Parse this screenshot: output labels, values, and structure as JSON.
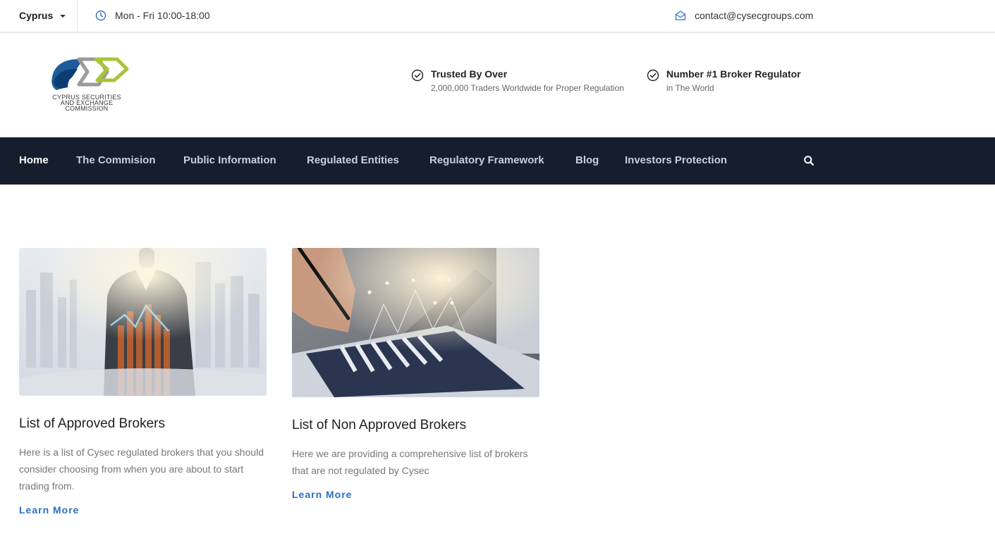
{
  "topbar": {
    "country": "Cyprus",
    "hours": "Mon - Fri 10:00-18:00",
    "email": "contact@cysecgroups.com"
  },
  "header": {
    "logo_text": [
      "CYPRUS SECURITIES",
      "AND EXCHANGE",
      "COMMISSION"
    ],
    "features": [
      {
        "title": "Trusted By Over",
        "subtitle": "2,000,000 Traders Worldwide for Proper Regulation"
      },
      {
        "title": "Number #1 Broker Regulator",
        "subtitle": "in The World"
      }
    ]
  },
  "nav": {
    "items": [
      {
        "label": "Home"
      },
      {
        "label": "The Commision"
      },
      {
        "label": "Public Information"
      },
      {
        "label": "Regulated Entities"
      },
      {
        "label": "Regulatory Framework"
      },
      {
        "label": "Blog"
      },
      {
        "label": "Investors Protection"
      }
    ]
  },
  "cards": [
    {
      "title": "List of Approved Brokers",
      "text": "Here is a list of Cysec regulated brokers that you should consider choosing from when you are about to start trading from.",
      "link": "Learn More"
    },
    {
      "title": "List of Non Approved Brokers",
      "text": "Here we are providing a comprehensive list of brokers that are not regulated by Cysec",
      "link": "Learn More"
    }
  ],
  "colors": {
    "nav_bg": "#161d2c",
    "accent_link": "#2a6fc9",
    "icon_blue": "#3b6fd1",
    "logo_blue": "#1d5b9a",
    "logo_green": "#a8c437",
    "logo_gray": "#9a9a9a"
  },
  "icons": {
    "hours": "clock-icon",
    "email": "envelope-open-icon",
    "feature": "check-circle-icon",
    "search": "search-icon",
    "country": "caret-down-icon"
  }
}
